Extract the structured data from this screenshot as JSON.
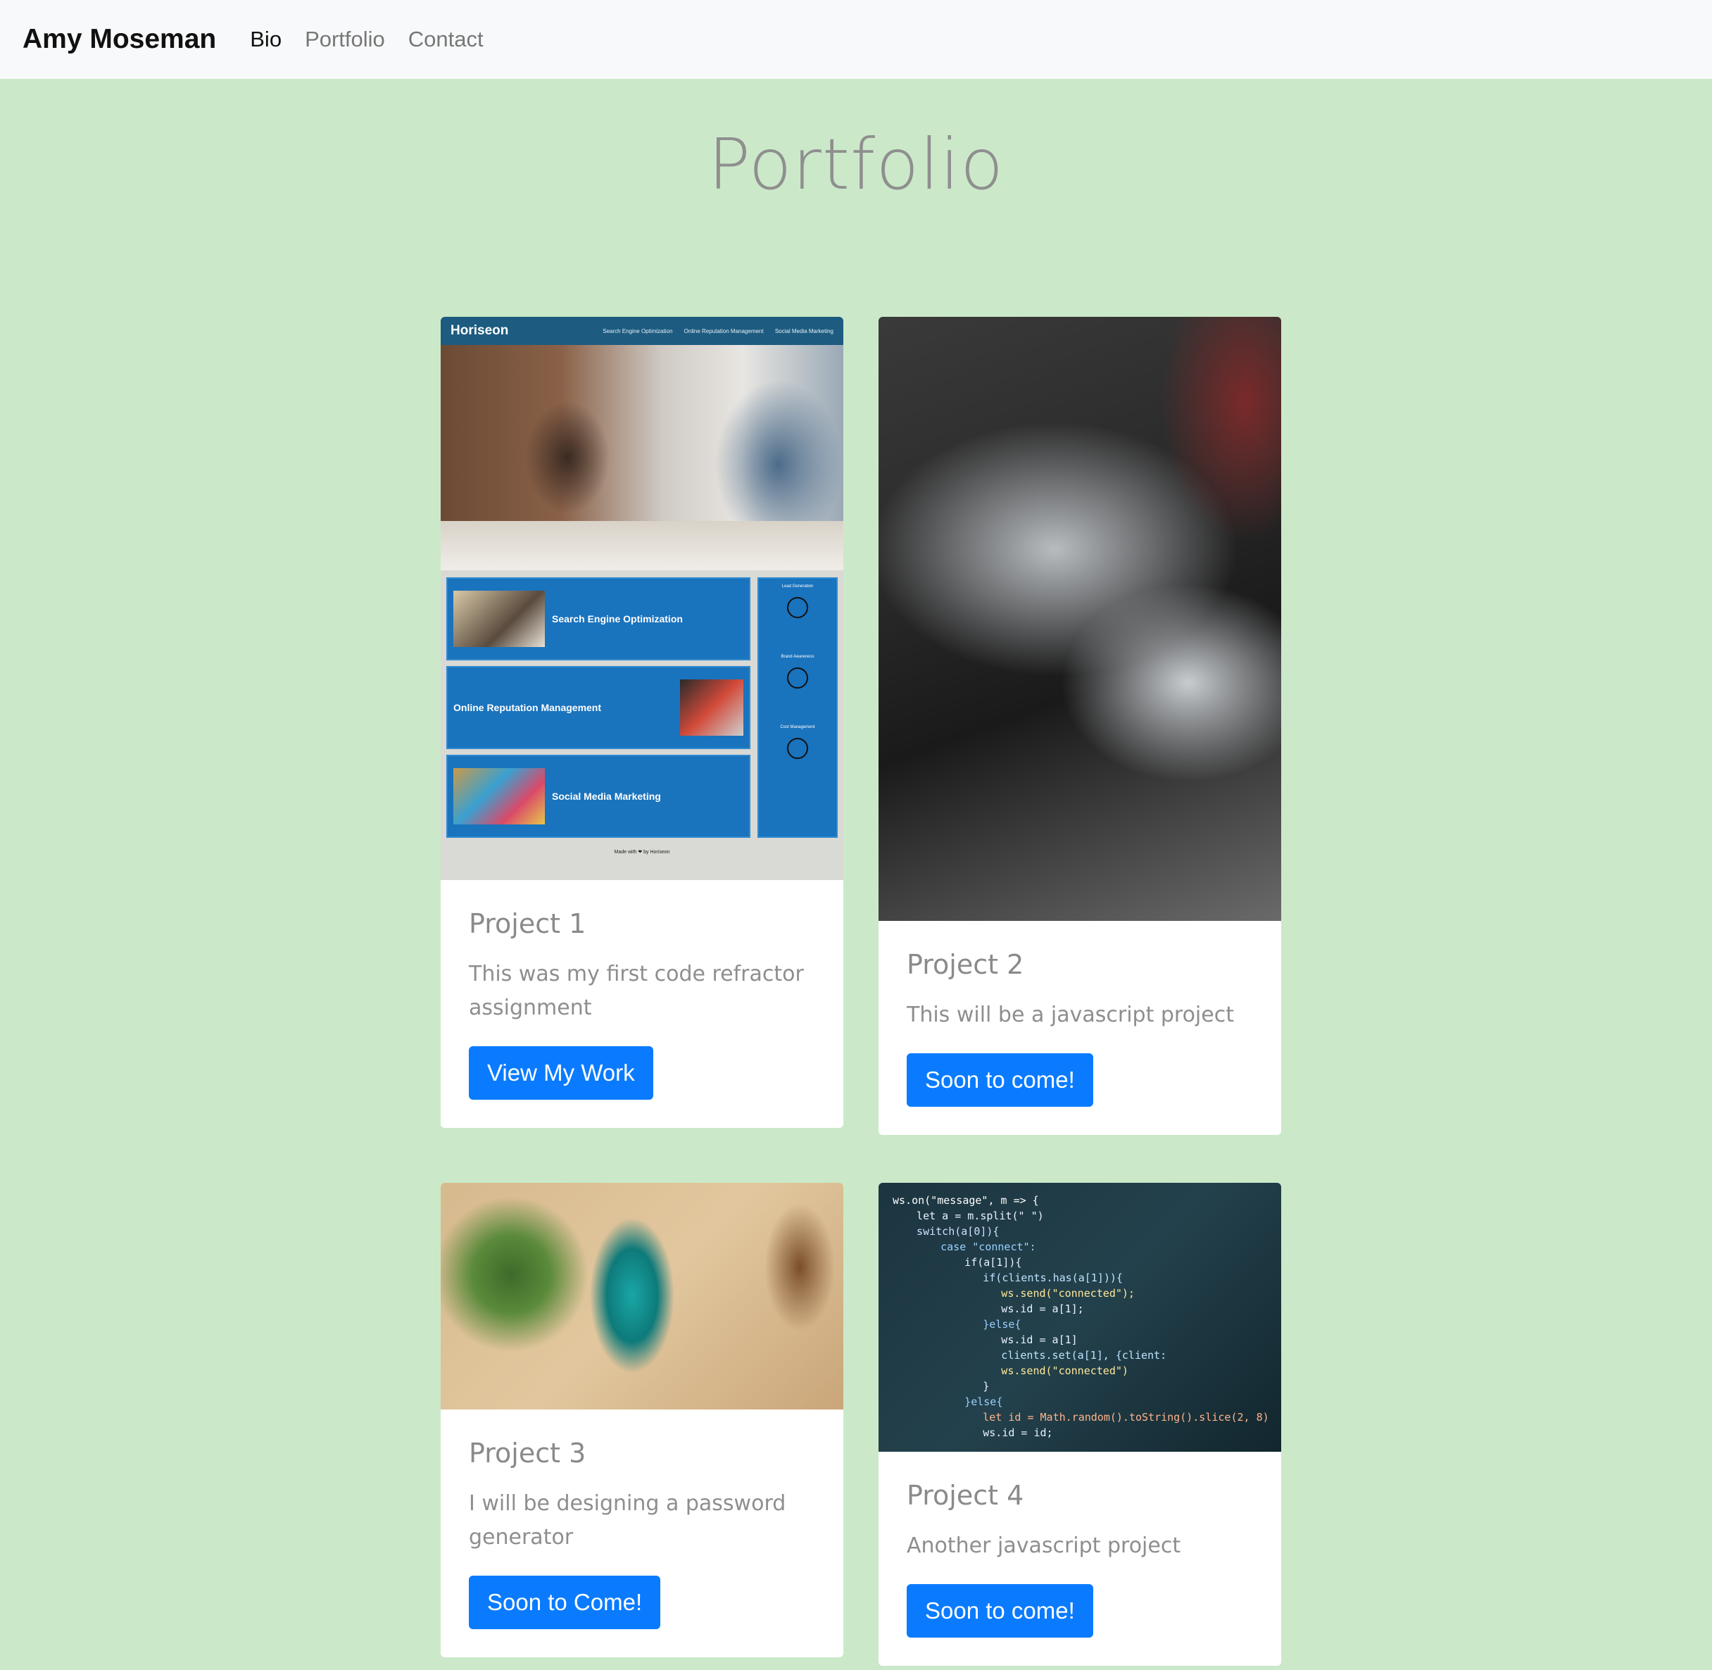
{
  "navbar": {
    "brand": "Amy Moseman",
    "links": [
      {
        "label": "Bio",
        "active": true
      },
      {
        "label": "Portfolio",
        "active": false
      },
      {
        "label": "Contact",
        "active": false
      }
    ]
  },
  "page_title": "Portfolio",
  "colors": {
    "page_background": "#cbe9c9",
    "navbar_background": "#f8f9fa",
    "button_primary": "#0a7bff"
  },
  "cards": [
    {
      "title": "Project 1",
      "text": "This was my first code refractor assignment",
      "button_label": "View My Work",
      "image": {
        "kind": "website-screenshot",
        "site_logo": "Horiseon",
        "site_nav": [
          "Search Engine Optimization",
          "Online Reputation Management",
          "Social Media Marketing"
        ],
        "sections": [
          "Search Engine Optimization",
          "Online Reputation Management",
          "Social Media Marketing"
        ],
        "aside": [
          "Lead Generation",
          "Brand Awareness",
          "Cost Management"
        ],
        "footer": "Made with ❤ by Horiseon"
      }
    },
    {
      "title": "Project 2",
      "text": "This will be a javascript project",
      "button_label": "Soon to come!",
      "image": {
        "kind": "photo-laptop"
      }
    },
    {
      "title": "Project 3",
      "text": "I will be designing a password generator",
      "button_label": "Soon to Come!",
      "image": {
        "kind": "photo-phone"
      }
    },
    {
      "title": "Project 4",
      "text": "Another javascript project",
      "button_label": "Soon to come!",
      "image": {
        "kind": "photo-code",
        "code_lines": [
          "ws.on(\"message\", m => {",
          "  let a = m.split(\" \")",
          "  switch(a[0]){",
          "    case \"connect\":",
          "      if(a[1]){",
          "        if(clients.has(a[1])){",
          "          ws.send(\"connected\");",
          "          ws.id = a[1];",
          "        }else{",
          "          ws.id = a[1]",
          "          clients.set(a[1], {client:",
          "          ws.send(\"connected\")",
          "        }",
          "      }else{",
          "        let id = Math.random().toString().slice(2, 8)",
          "        ws.id = id;"
        ]
      }
    }
  ]
}
